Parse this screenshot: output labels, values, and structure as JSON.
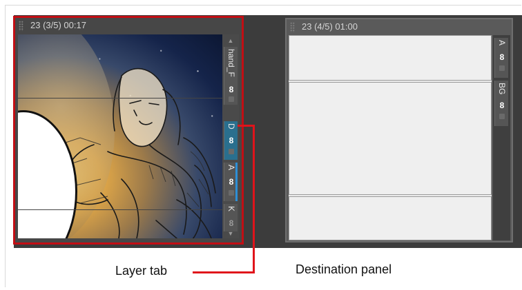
{
  "panels": {
    "left": {
      "header": "23 (3/5) 00:17",
      "layers": [
        {
          "label": "hand_F",
          "active": false
        },
        {
          "label": "D",
          "active": true
        },
        {
          "label": "A",
          "active": false
        },
        {
          "label": "K",
          "active": false
        }
      ]
    },
    "right": {
      "header": "23 (4/5) 01:00",
      "layers": [
        {
          "label": "A"
        },
        {
          "label": "BG"
        }
      ]
    }
  },
  "captions": {
    "layer_tab": "Layer tab",
    "destination_panel": "Destination panel"
  },
  "colors": {
    "highlight": "#c20e14",
    "callout": "#e0141b",
    "active_tab": "#2a6f8e"
  },
  "icons": {
    "visibility": "eye-icon",
    "lock": "lock-icon",
    "grip": "grip-icon",
    "scroll_up": "arrow-up-icon",
    "scroll_down": "arrow-down-icon"
  }
}
